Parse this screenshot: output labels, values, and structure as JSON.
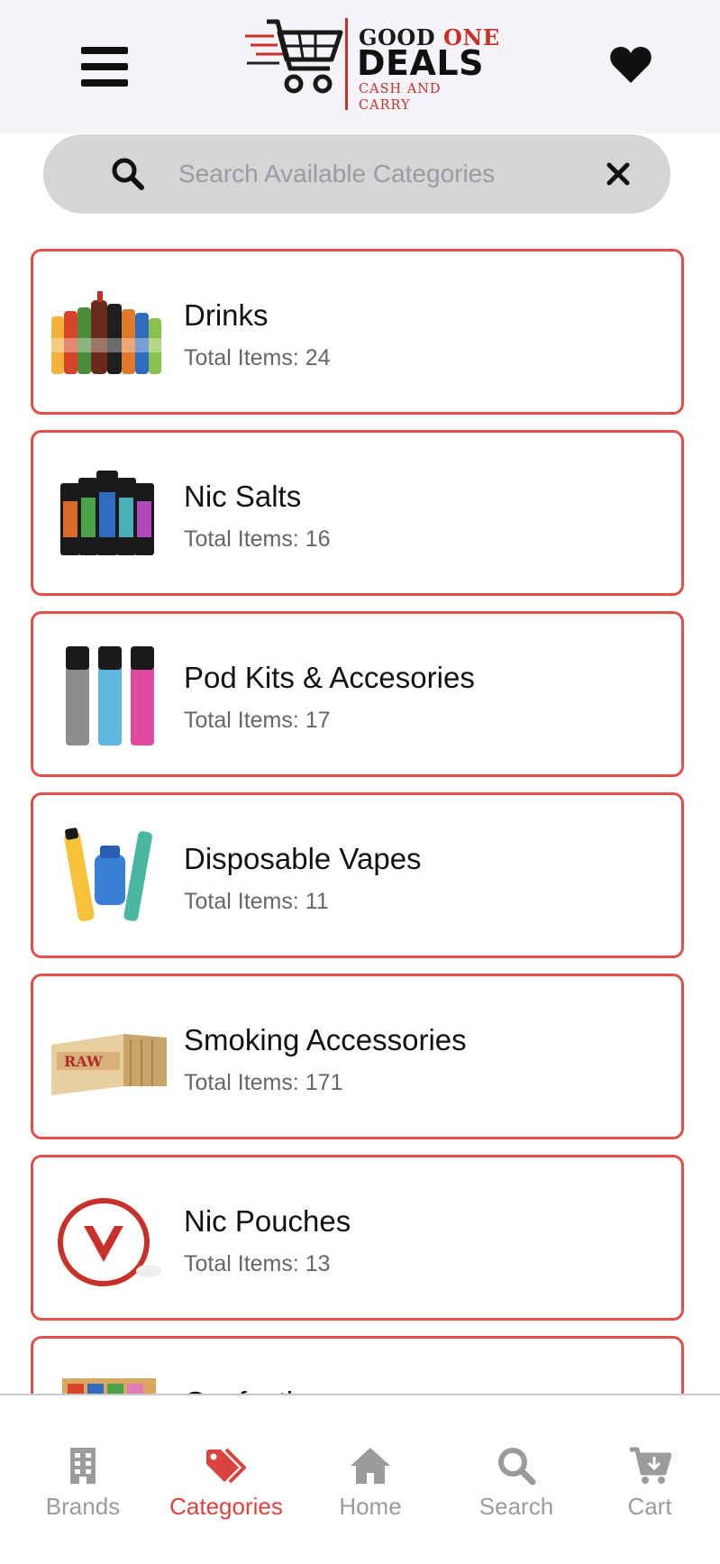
{
  "header": {
    "logo": {
      "top_left": "GOOD",
      "top_right": "ONE",
      "main": "DEALS",
      "tagline": "CASH AND CARRY"
    },
    "menu_icon": "hamburger-menu-icon",
    "favorites_icon": "heart-icon"
  },
  "search": {
    "placeholder": "Search Available Categories",
    "value": "",
    "icon": "search-icon",
    "clear_icon": "close-icon"
  },
  "categories": [
    {
      "name": "Drinks",
      "count": "Total Items: 24",
      "image": "soft-drink-bottles"
    },
    {
      "name": "Nic Salts",
      "count": "Total Items: 16",
      "image": "e-liquid-bottles"
    },
    {
      "name": "Pod Kits & Accesories",
      "count": "Total Items: 17",
      "image": "pod-kit-devices"
    },
    {
      "name": "Disposable Vapes",
      "count": "Total Items: 11",
      "image": "disposable-vape-devices"
    },
    {
      "name": "Smoking Accessories",
      "count": "Total Items: 171",
      "image": "rolling-paper-box"
    },
    {
      "name": "Nic Pouches",
      "count": "Total Items: 13",
      "image": "nicotine-pouch-tin"
    },
    {
      "name": "Confectionery",
      "count": "",
      "image": "confectionery-box"
    }
  ],
  "bottom_nav": [
    {
      "label": "Brands",
      "icon": "building-icon",
      "active": false
    },
    {
      "label": "Categories",
      "icon": "tags-icon",
      "active": true
    },
    {
      "label": "Home",
      "icon": "home-icon",
      "active": false
    },
    {
      "label": "Search",
      "icon": "search-icon",
      "active": false
    },
    {
      "label": "Cart",
      "icon": "cart-icon",
      "active": false
    }
  ],
  "colors": {
    "accent": "#d9443e",
    "card_border": "#e05048",
    "header_bg": "#f6f4f9",
    "search_bg": "#d5d5d5",
    "nav_inactive": "#9b9b9b"
  }
}
